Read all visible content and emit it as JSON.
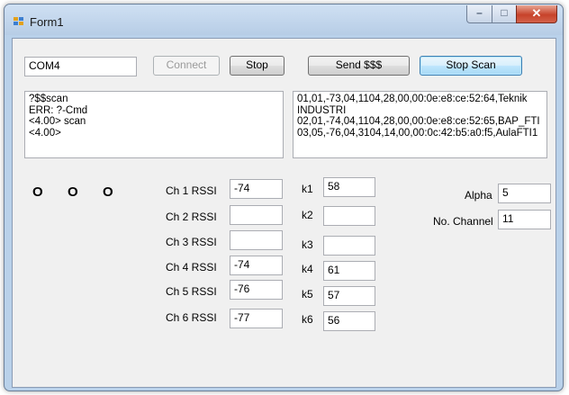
{
  "window": {
    "title": "Form1"
  },
  "controls": {
    "minimize": "–",
    "maximize": "□",
    "close": "✕"
  },
  "icons": {
    "app": "form-app-icon"
  },
  "port_field": {
    "value": "COM4"
  },
  "buttons": {
    "connect": "Connect",
    "stop": "Stop",
    "send": "Send $$$",
    "stop_scan": "Stop Scan"
  },
  "log_left": [
    "?$$scan",
    "ERR: ?-Cmd",
    "<4.00> scan",
    "<4.00>"
  ],
  "log_right": [
    "01,01,-73,04,1104,28,00,00:0e:e8:ce:52:64,Teknik",
    "INDUSTRI",
    "02,01,-74,04,1104,28,00,00:0e:e8:ce:52:65,BAP_FTI",
    "03,05,-76,04,3104,14,00,00:0c:42:b5:a0:f5,AulaFTI1"
  ],
  "indicators": [
    "O",
    "O",
    "O"
  ],
  "channels": [
    {
      "label": "Ch 1 RSSI",
      "value": "-74"
    },
    {
      "label": "Ch 2 RSSI",
      "value": ""
    },
    {
      "label": "Ch 3 RSSI",
      "value": ""
    },
    {
      "label": "Ch 4 RSSI",
      "value": "-74"
    },
    {
      "label": "Ch 5 RSSI",
      "value": "-76"
    },
    {
      "label": "Ch 6 RSSI",
      "value": "-77"
    }
  ],
  "k_values": [
    {
      "label": "k1",
      "value": "58"
    },
    {
      "label": "k2",
      "value": ""
    },
    {
      "label": "k3",
      "value": ""
    },
    {
      "label": "k4",
      "value": "61"
    },
    {
      "label": "k5",
      "value": "57"
    },
    {
      "label": "k6",
      "value": "56"
    }
  ],
  "alpha": {
    "label": "Alpha",
    "value": "5"
  },
  "no_channel": {
    "label": "No. Channel",
    "value": "11"
  },
  "colors": {
    "title_bar": "#b9d1ea",
    "client_bg": "#f0f0f0",
    "close_button": "#c7432a",
    "focus_blue": "#3c7fb1"
  }
}
